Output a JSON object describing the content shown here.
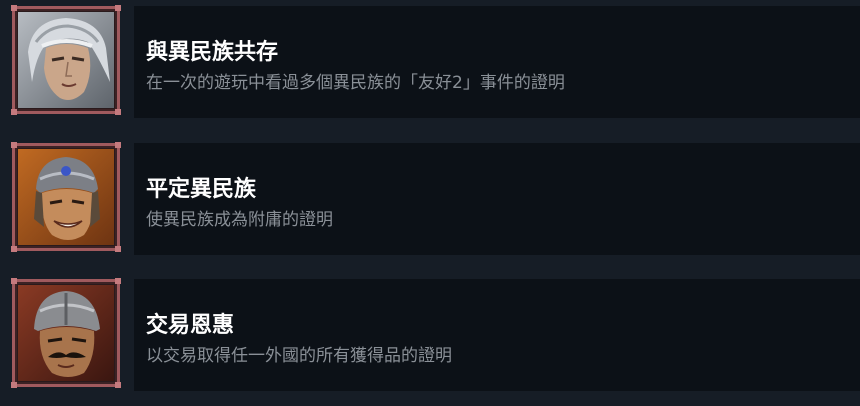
{
  "achievements": [
    {
      "title": "與異民族共存",
      "description": "在一次的遊玩中看過多個異民族的「友好2」事件的證明",
      "portrait_icon": "warrior-portrait-silver-hair",
      "colors": {
        "skin": "#c9a88c",
        "hair": "#c8ccd0",
        "background": "#8a9096"
      }
    },
    {
      "title": "平定異民族",
      "description": "使異民族成為附庸的證明",
      "portrait_icon": "warrior-portrait-helmet-smiling",
      "colors": {
        "skin": "#c08a5a",
        "hair": "#3a2a1e",
        "background": "#a4581e"
      }
    },
    {
      "title": "交易恩惠",
      "description": "以交易取得任一外國的所有獲得品的證明",
      "portrait_icon": "warrior-portrait-helmet-mustache",
      "colors": {
        "skin": "#a8744c",
        "hair": "#2c2018",
        "background": "#6a2a1c"
      }
    }
  ],
  "colors": {
    "page_background": "#161d26",
    "panel_background": "#0c1117",
    "frame_border": "#a05a5e",
    "title_text": "#ffffff",
    "description_text": "#8a9097"
  }
}
